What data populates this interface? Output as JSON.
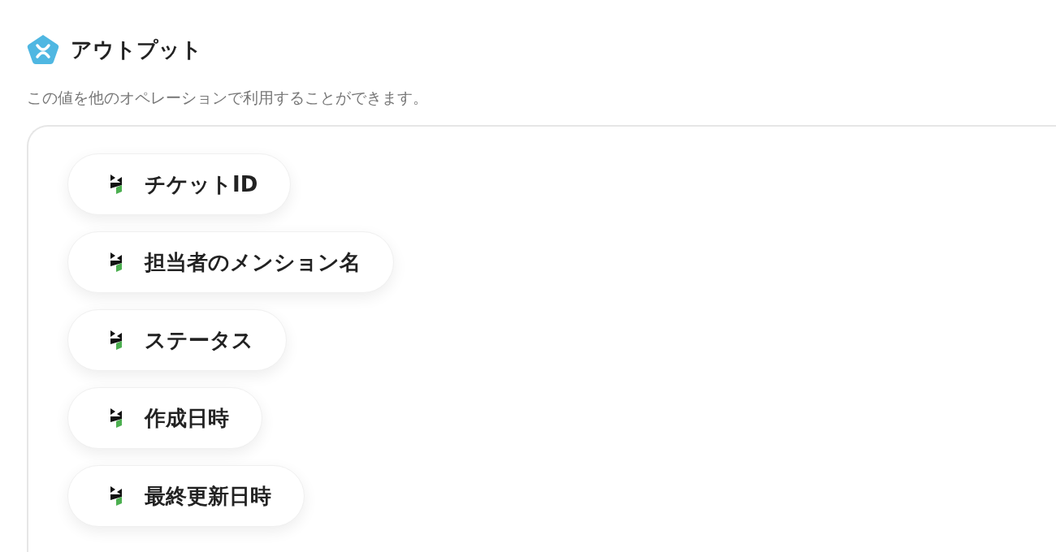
{
  "header": {
    "title": "アウトプット",
    "description": "この値を他のオペレーションで利用することができます。"
  },
  "outputs": [
    {
      "label": "チケットID"
    },
    {
      "label": "担当者のメンション名"
    },
    {
      "label": "ステータス"
    },
    {
      "label": "作成日時"
    },
    {
      "label": "最終更新日時"
    }
  ]
}
